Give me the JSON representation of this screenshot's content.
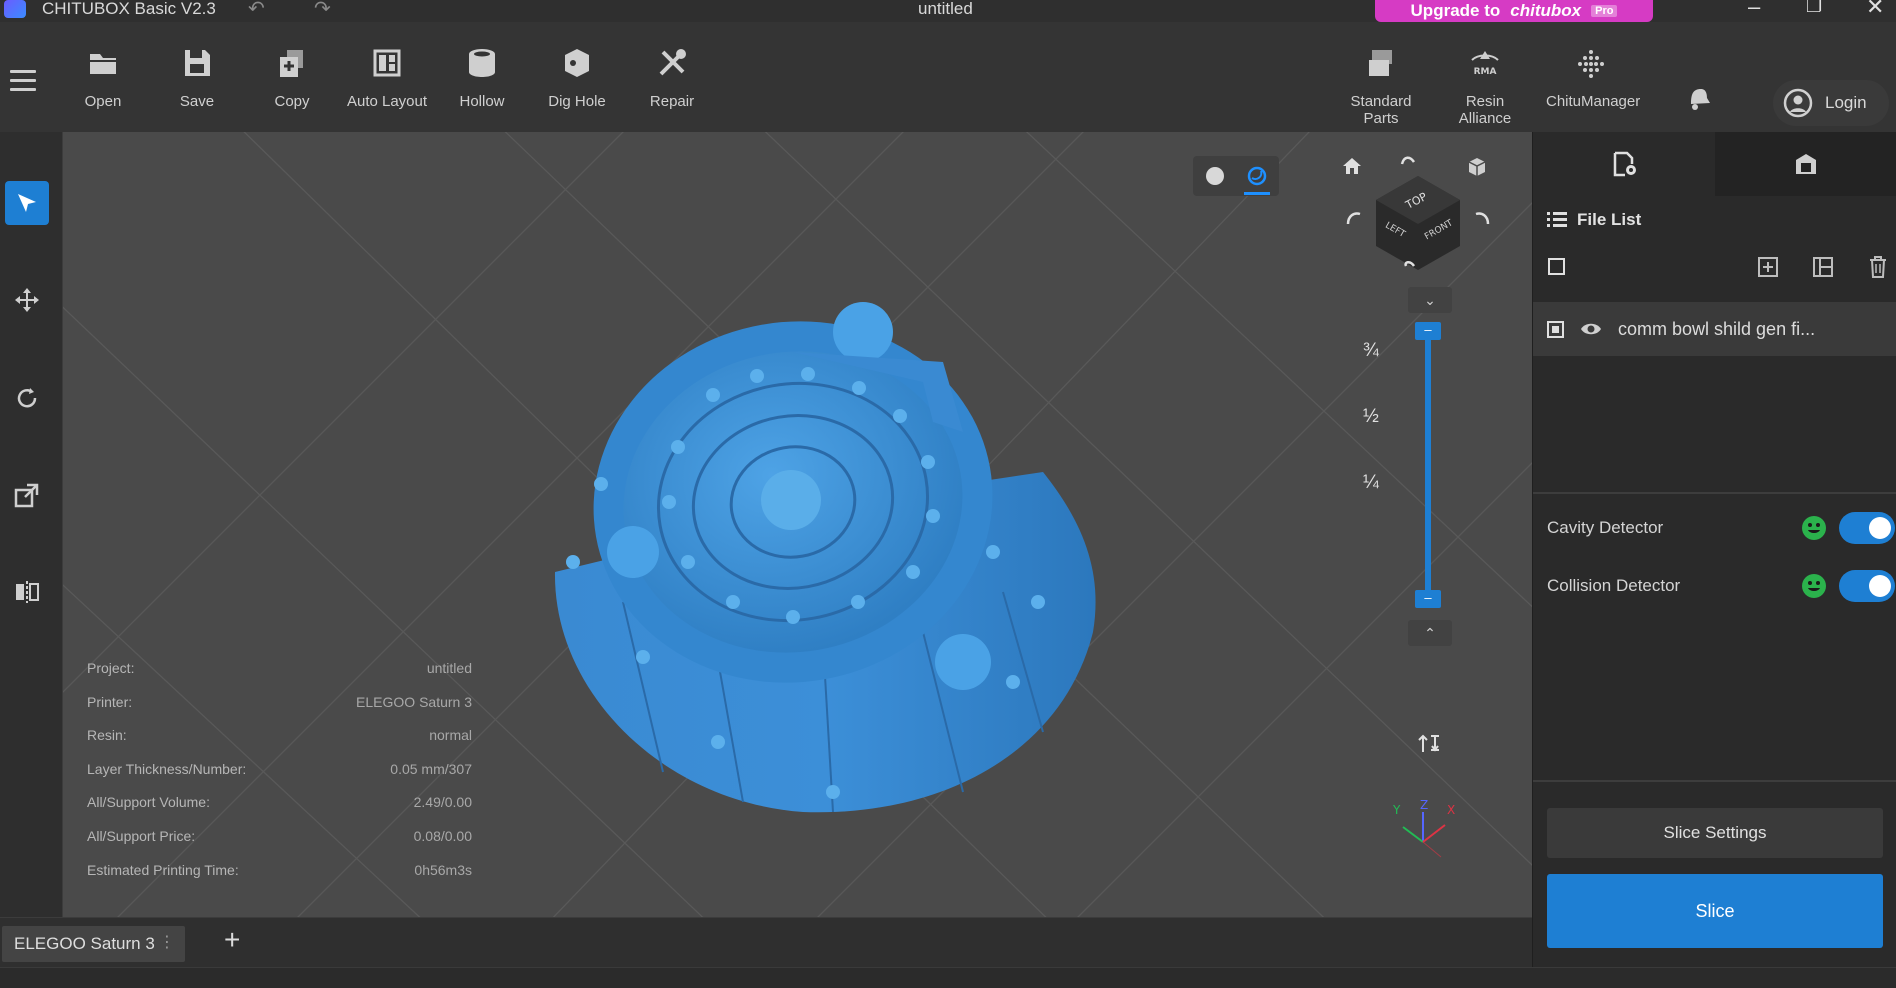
{
  "app": {
    "title": "CHITUBOX Basic V2.3",
    "document_title": "untitled"
  },
  "upgrade": {
    "prefix": "Upgrade to",
    "brand": "chitubox",
    "badge": "Pro"
  },
  "toolbar": {
    "tools": [
      {
        "label": "Open",
        "icon": "folder-open-icon"
      },
      {
        "label": "Save",
        "icon": "save-icon"
      },
      {
        "label": "Copy",
        "icon": "copy-icon"
      },
      {
        "label": "Auto Layout",
        "icon": "auto-layout-icon"
      },
      {
        "label": "Hollow",
        "icon": "hollow-icon"
      },
      {
        "label": "Dig Hole",
        "icon": "dig-hole-icon"
      },
      {
        "label": "Repair",
        "icon": "repair-icon"
      }
    ],
    "right_tools": [
      {
        "label": "Standard Parts",
        "icon": "standard-parts-icon"
      },
      {
        "label": "Resin Alliance",
        "icon": "resin-alliance-icon"
      },
      {
        "label": "ChituManager",
        "icon": "chitumanager-icon"
      }
    ],
    "login_label": "Login"
  },
  "info": {
    "rows": [
      {
        "key": "Project:",
        "value": "untitled"
      },
      {
        "key": "Printer:",
        "value": "ELEGOO Saturn 3"
      },
      {
        "key": "Resin:",
        "value": "normal"
      },
      {
        "key": "Layer Thickness/Number:",
        "value": "0.05 mm/307"
      },
      {
        "key": "All/Support Volume:",
        "value": "2.49/0.00"
      },
      {
        "key": "All/Support Price:",
        "value": "0.08/0.00"
      },
      {
        "key": "Estimated Printing Time:",
        "value": "0h56m3s"
      }
    ]
  },
  "view_cube": {
    "top": "TOP",
    "left": "LEFT",
    "front": "FRONT"
  },
  "layer_slider": {
    "marks": [
      "¾",
      "½",
      "¼"
    ],
    "top_value": "–",
    "bottom_value": "–"
  },
  "axes": {
    "x": "X",
    "y": "Y",
    "z": "Z"
  },
  "panel": {
    "file_list_title": "File List",
    "files": [
      {
        "name": "comm bowl shild gen fi..."
      }
    ],
    "detectors": [
      {
        "label": "Cavity Detector"
      },
      {
        "label": "Collision Detector"
      }
    ],
    "slice_settings_label": "Slice Settings",
    "slice_label": "Slice"
  },
  "bottom": {
    "printer_tab": "ELEGOO Saturn 3",
    "add_label": "+"
  },
  "colors": {
    "accent": "#1e7fd3",
    "upgrade": "#d63bc4",
    "model": "#3a8fd6",
    "viewport": "#4a4a4a"
  }
}
